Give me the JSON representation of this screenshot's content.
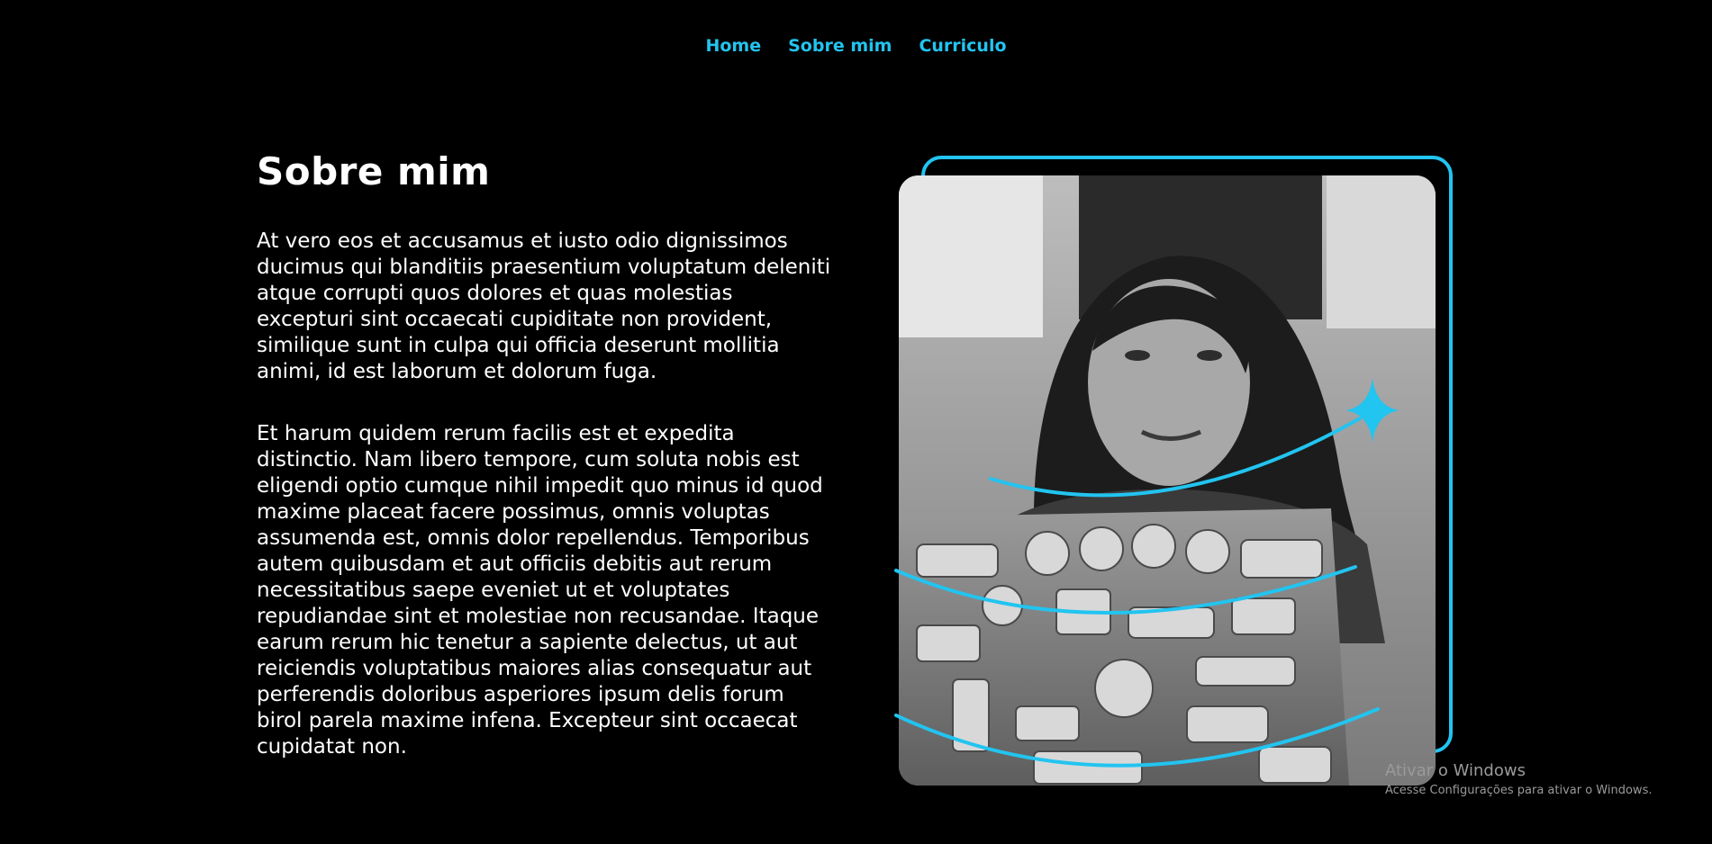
{
  "nav": {
    "items": [
      {
        "label": "Home"
      },
      {
        "label": "Sobre mim"
      },
      {
        "label": "Curriculo"
      }
    ]
  },
  "about": {
    "title": "Sobre mim",
    "paragraphs": [
      "At vero eos et accusamus et iusto odio dignissimos ducimus qui blanditiis praesentium voluptatum deleniti atque corrupti quos dolores et quas molestias excepturi sint occaecati cupiditate non provident, similique sunt in culpa qui officia deserunt mollitia animi, id est laborum et dolorum fuga.",
      "Et harum quidem rerum facilis est et expedita distinctio. Nam libero tempore, cum soluta nobis est eligendi optio cumque nihil impedit quo minus id quod maxime placeat facere possimus, omnis voluptas assumenda est, omnis dolor repellendus. Temporibus autem quibusdam et aut officiis debitis aut rerum necessitatibus saepe eveniet ut et voluptates repudiandae sint et molestiae non recusandae. Itaque earum rerum hic tenetur a sapiente delectus, ut aut reiciendis voluptatibus maiores alias consequatur aut perferendis doloribus asperiores ipsum delis forum birol parela maxime infena. Excepteur sint occaecat cupidatat non."
    ],
    "photo_icon": "profile-photo",
    "frame_icon": "accent-frame",
    "sparkle_icon": "four-point-star-icon"
  },
  "colors": {
    "background": "#000000",
    "accent": "#22c4f0",
    "text": "#ffffff"
  },
  "watermark": {
    "line1": "Ativar o Windows",
    "line2": "Acesse Configurações para ativar o Windows."
  }
}
